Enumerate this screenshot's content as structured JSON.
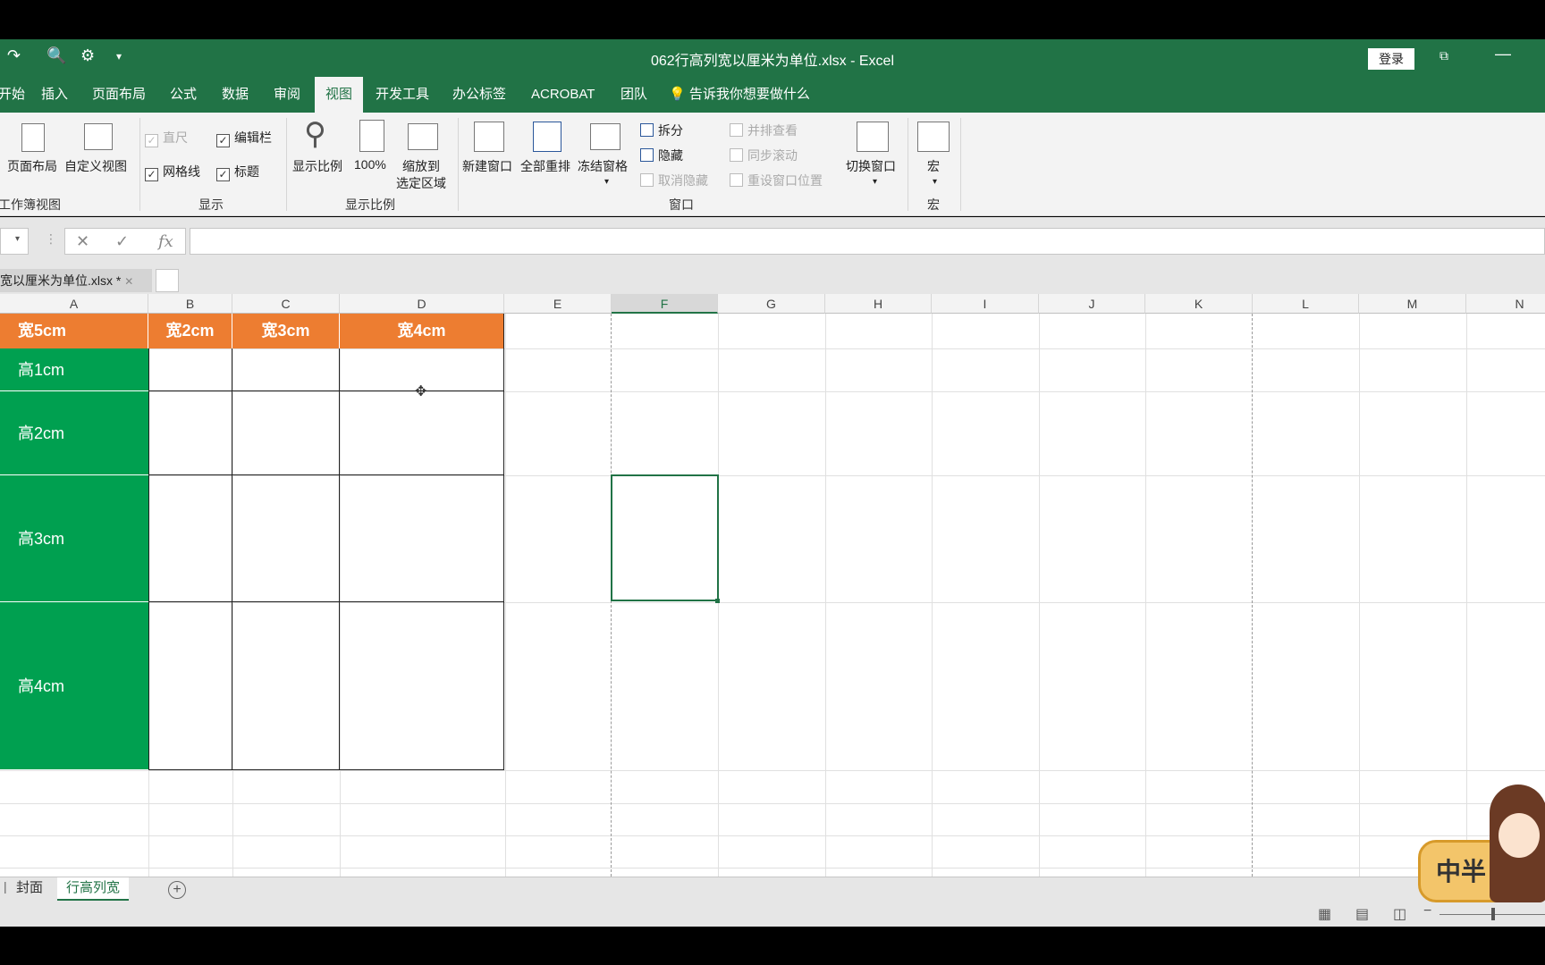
{
  "window": {
    "title": "062行高列宽以厘米为单位.xlsx  -  Excel",
    "login_label": "登录"
  },
  "tabs": [
    "开始",
    "插入",
    "页面布局",
    "公式",
    "数据",
    "审阅",
    "视图",
    "开发工具",
    "办公标签",
    "ACROBAT",
    "团队"
  ],
  "active_tab": "视图",
  "tell_me": "告诉我你想要做什么",
  "ribbon": {
    "workbook_views": {
      "page_layout": "页面布局",
      "custom_views": "自定义视图",
      "label": "工作簿视图"
    },
    "show": {
      "ruler": "直尺",
      "formula_bar": "编辑栏",
      "gridlines": "网格线",
      "headings": "标题",
      "label": "显示"
    },
    "zoom": {
      "zoom": "显示比例",
      "hundred": "100%",
      "zoom_to_selection_1": "缩放到",
      "zoom_to_selection_2": "选定区域",
      "label": "显示比例"
    },
    "window": {
      "new_window": "新建窗口",
      "arrange_all": "全部重排",
      "freeze_panes": "冻结窗格",
      "split": "拆分",
      "hide": "隐藏",
      "unhide": "取消隐藏",
      "view_side_by_side": "并排查看",
      "sync_scroll": "同步滚动",
      "reset_position": "重设窗口位置",
      "switch_windows": "切换窗口",
      "label": "窗口"
    },
    "macros": {
      "macros": "宏",
      "label": "宏"
    }
  },
  "formula": {
    "cancel": "✕",
    "enter": "✓",
    "fx": "fx"
  },
  "doc_tab": "宽以厘米为单位.xlsx *",
  "columns": [
    "A",
    "B",
    "C",
    "D",
    "E",
    "F",
    "G",
    "H",
    "I",
    "J",
    "K",
    "L",
    "M",
    "N"
  ],
  "selected_column": "F",
  "table": {
    "col_headers": [
      "宽5cm",
      "宽2cm",
      "宽3cm",
      "宽4cm"
    ],
    "row_headers": [
      "高1cm",
      "高2cm",
      "高3cm",
      "高4cm"
    ]
  },
  "sheets": [
    "封面",
    "行高列宽"
  ],
  "active_sheet": "行高列宽",
  "sticker_text": "中半",
  "colors": {
    "excel_green": "#217346",
    "header_orange": "#ed7d31",
    "row_green": "#00a050"
  }
}
